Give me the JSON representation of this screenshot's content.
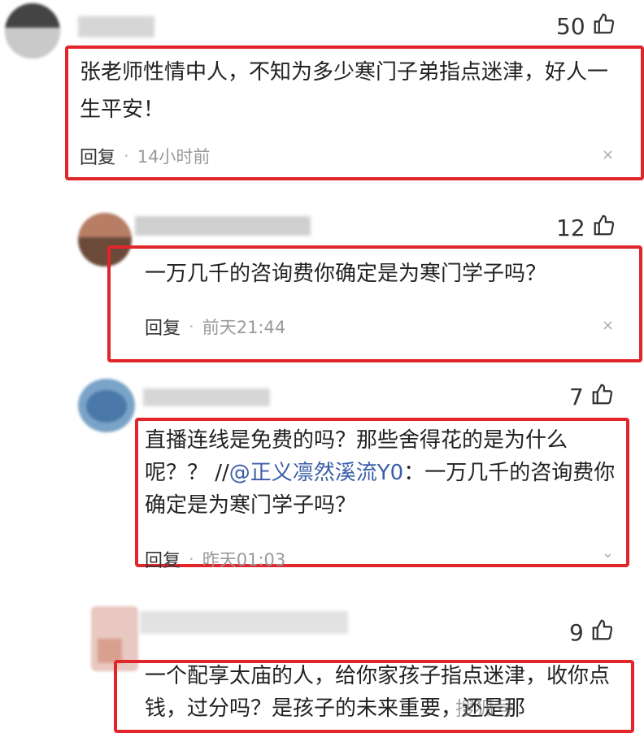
{
  "comments": [
    {
      "likes": "50",
      "text": "张老师性情中人，不知为多少寒门子弟指点迷津，好人一生平安！",
      "reply": "回复",
      "dot": "·",
      "time": "14小时前",
      "close": "×"
    },
    {
      "likes": "12",
      "text": "一万几千的咨询费你确定是为寒门学子吗？",
      "reply": "回复",
      "dot": "·",
      "time": "前天21:44",
      "close": "×"
    },
    {
      "likes": "7",
      "text_before": "直播连线是免费的吗？那些舍得花的是为什么呢？？ //",
      "mention": "@正义凛然溪流Y0",
      "text_after": "：一万几千的咨询费你确定是为寒门学子吗？",
      "reply": "回复",
      "dot": "·",
      "time": "昨天01:03",
      "close": "⌄"
    },
    {
      "likes": "9",
      "text": "一个配享太庙的人，给你家孩子指点迷津，收你点钱，过分吗？是孩子的未来重要，还是那"
    }
  ],
  "watermark": "搜狐号"
}
